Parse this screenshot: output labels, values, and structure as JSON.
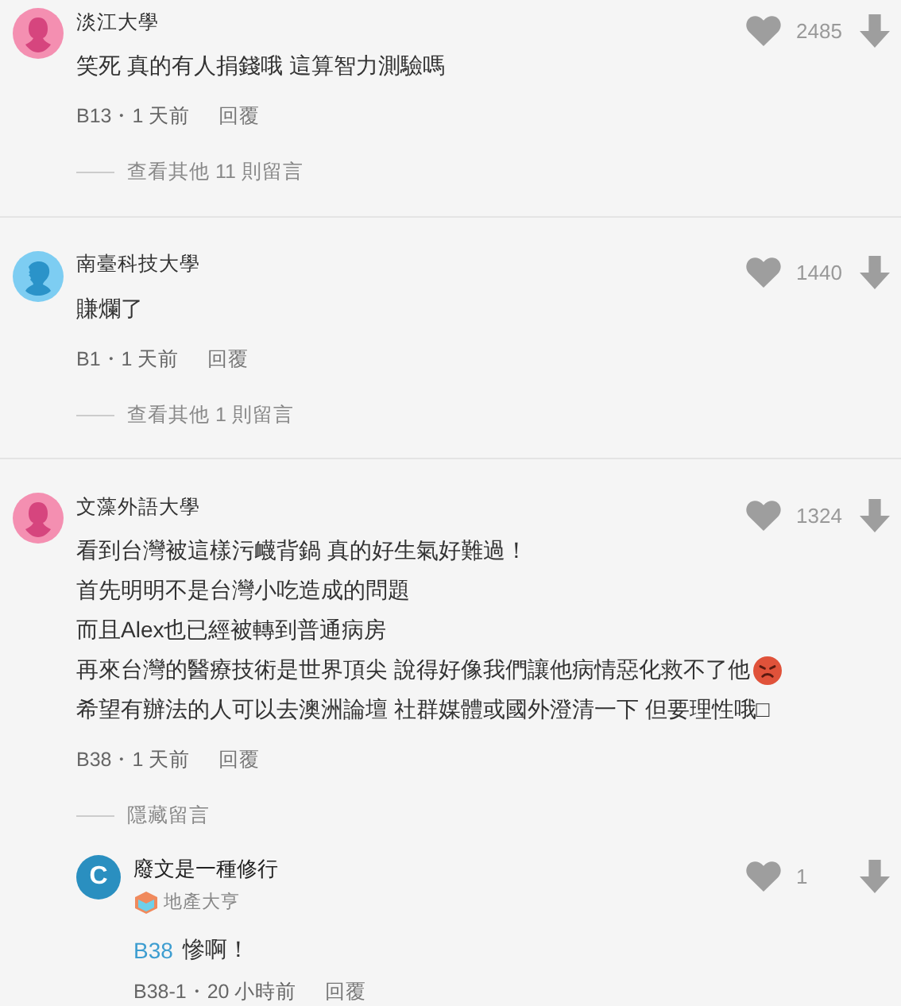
{
  "comments": [
    {
      "avatar": {
        "kind": "female"
      },
      "author": "淡江大學",
      "likes": "2485",
      "lines": [
        {
          "text": "笑死 真的有人捐錢哦 這算智力測驗嗎"
        }
      ],
      "meta": "B13・1 天前",
      "reply_label": "回覆",
      "thread_toggle": "查看其他 11 則留言"
    },
    {
      "avatar": {
        "kind": "male"
      },
      "author": "南臺科技大學",
      "likes": "1440",
      "lines": [
        {
          "text": "賺爛了"
        }
      ],
      "meta": "B1・1 天前",
      "reply_label": "回覆",
      "thread_toggle": "查看其他 1 則留言"
    },
    {
      "avatar": {
        "kind": "female"
      },
      "author": "文藻外語大學",
      "likes": "1324",
      "lines": [
        {
          "text": "看到台灣被這樣污衊背鍋 真的好生氣好難過！"
        },
        {
          "text": "首先明明不是台灣小吃造成的問題"
        },
        {
          "text": "而且Alex也已經被轉到普通病房"
        },
        {
          "text": "再來台灣的醫療技術是世界頂尖 說得好像我們讓他病情惡化救不了他",
          "kind": "angry-emoji-end"
        },
        {
          "text": "希望有辦法的人可以去澳洲論壇 社群媒體或國外澄清一下 但要理性哦□"
        }
      ],
      "meta": "B38・1 天前",
      "reply_label": "回覆",
      "thread_toggle": "隱藏留言",
      "replies": [
        {
          "avatar": {
            "kind": "letter",
            "letter": "C"
          },
          "author": "廢文是一種修行",
          "badge": "地產大亨",
          "likes": "1",
          "mention": "B38",
          "lines": [
            {
              "text": "慘啊！"
            }
          ],
          "meta": "B38-1・20 小時前",
          "reply_label": "回覆"
        }
      ]
    }
  ]
}
